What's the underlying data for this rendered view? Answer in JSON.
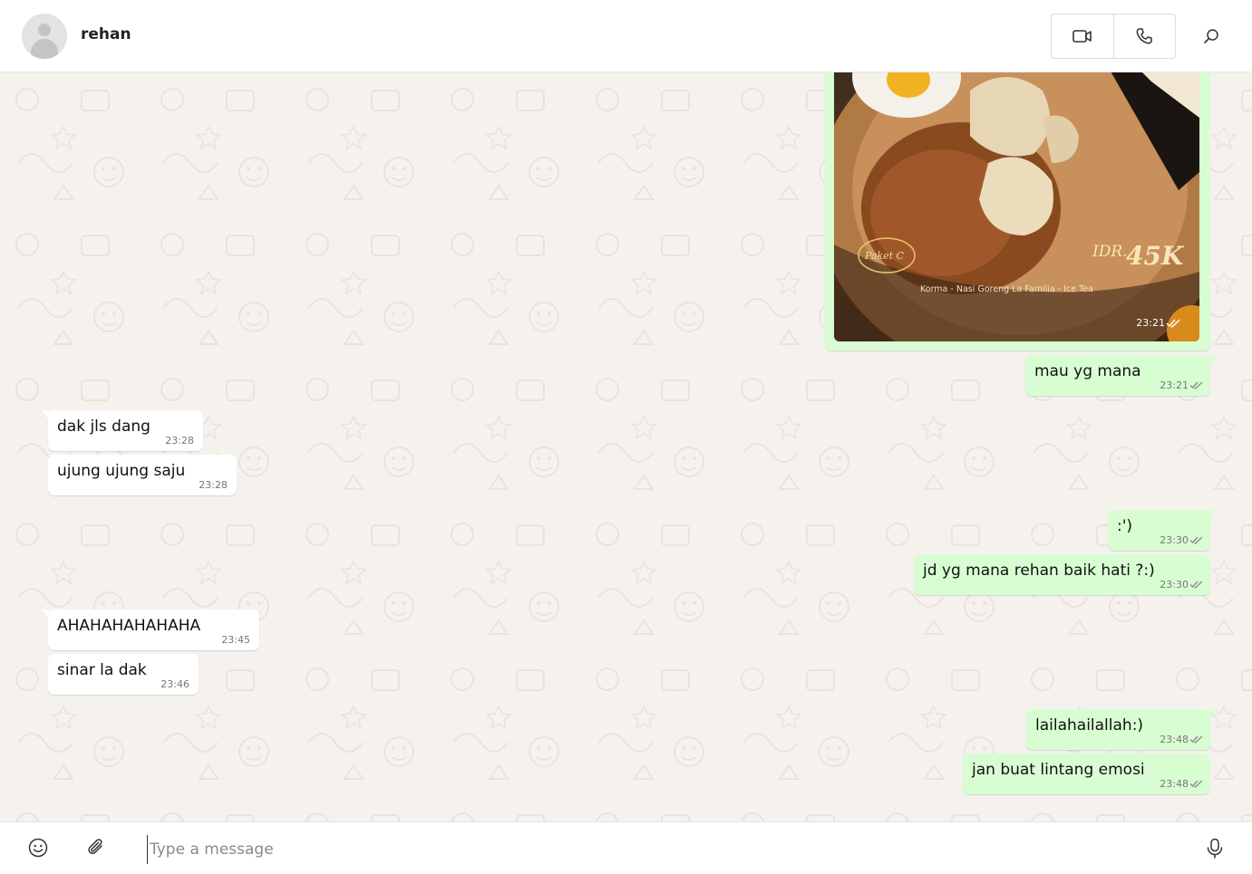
{
  "header": {
    "contact_name": "rehan"
  },
  "image_message": {
    "badge": "Paket C",
    "price_prefix": "IDR.",
    "price": "45K",
    "caption": "Korma - Nasi Goreng La Familia - Ice Tea",
    "time": "23:21"
  },
  "messages": [
    {
      "dir": "out",
      "text": "mau yg mana",
      "time": "23:21"
    },
    {
      "dir": "in",
      "text": "dak jls dang",
      "time": "23:28"
    },
    {
      "dir": "in",
      "text": "ujung ujung saju",
      "time": "23:28"
    },
    {
      "dir": "out",
      "text": ":')",
      "time": "23:30"
    },
    {
      "dir": "out",
      "text": "jd yg mana rehan baik hati ?:)",
      "time": "23:30"
    },
    {
      "dir": "in",
      "text": "AHAHAHAHAHAHA",
      "time": "23:45"
    },
    {
      "dir": "in",
      "text": "sinar la dak",
      "time": "23:46"
    },
    {
      "dir": "out",
      "text": "lailahailallah:)",
      "time": "23:48"
    },
    {
      "dir": "out",
      "text": "jan buat lintang emosi",
      "time": "23:48"
    }
  ],
  "composer": {
    "placeholder": "Type a message"
  },
  "colors": {
    "outgoing_bubble": "#d9fdd3",
    "incoming_bubble": "#ffffff",
    "chat_background": "#f5f2ee",
    "read_tick": "#8a8a8a"
  }
}
